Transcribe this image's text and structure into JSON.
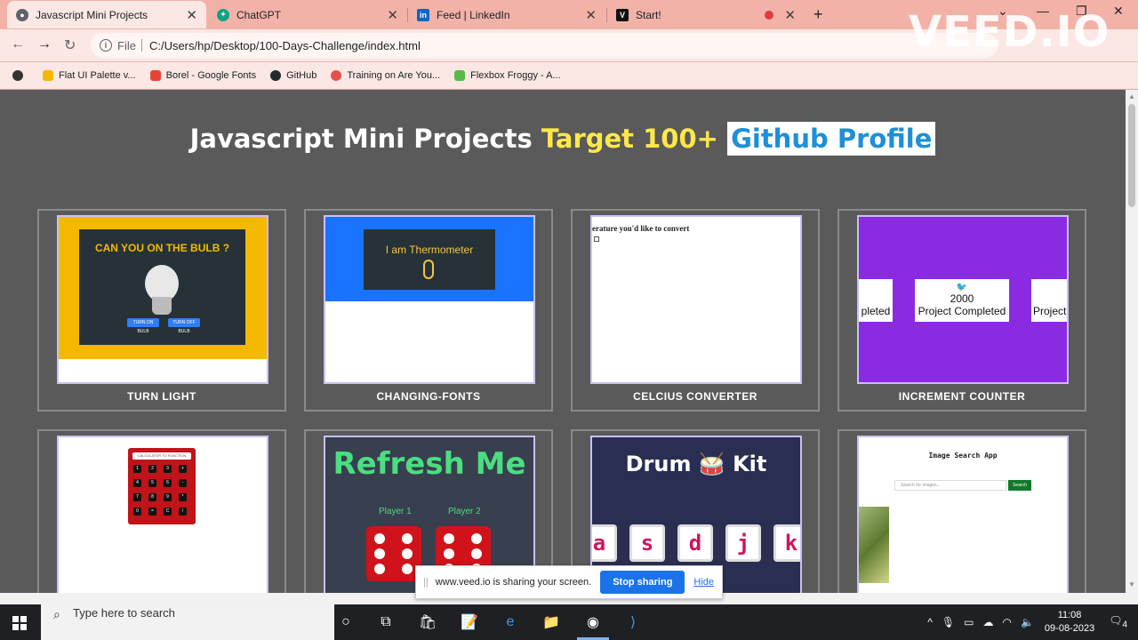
{
  "browser": {
    "tabs": [
      {
        "title": "Javascript Mini Projects",
        "active": true,
        "favicon_color": "#5f6368"
      },
      {
        "title": "ChatGPT",
        "active": false,
        "favicon_color": "#10a37f"
      },
      {
        "title": "Feed | LinkedIn",
        "active": false,
        "favicon_color": "#0a66c2"
      },
      {
        "title": "Start!",
        "active": false,
        "favicon_color": "#111111"
      }
    ],
    "new_tab": "+",
    "address": {
      "scheme": "File",
      "url": "C:/Users/hp/Desktop/100-Days-Challenge/index.html"
    },
    "bookmarks": [
      {
        "label": "Flat UI Palette v...",
        "color": "#f5b800"
      },
      {
        "label": "Borel - Google Fonts",
        "color": "#ea4335"
      },
      {
        "label": "GitHub",
        "color": "#24292e"
      },
      {
        "label": "Training on Are You...",
        "color": "#e94e4e"
      },
      {
        "label": "Flexbox Froggy - A...",
        "color": "#57b947"
      }
    ],
    "watermark": "VEED.IO"
  },
  "page": {
    "heading": {
      "part1": "Javascript Mini Projects",
      "part2": "Target 100+",
      "part3": "Github Profile"
    },
    "cards": [
      {
        "label": "TURN LIGHT"
      },
      {
        "label": "CHANGING-FONTS"
      },
      {
        "label": "CELCIUS CONVERTER"
      },
      {
        "label": "INCREMENT COUNTER"
      },
      {
        "label": ""
      },
      {
        "label": ""
      },
      {
        "label": ""
      },
      {
        "label": ""
      }
    ],
    "thumbs": {
      "bulb_title": "CAN YOU ON THE BULB ?",
      "bulb_btn_on": "TURN ON BULB",
      "bulb_btn_off": "TURN OFF BULB",
      "thermo_title": "I am Thermometer",
      "conv_text": "erature you'd like to convert",
      "counter_left": "pleted",
      "counter_num": "2000",
      "counter_mid": "Project Completed",
      "counter_right": "Project",
      "calc_screen": "CALCULATOR TO FUNCTION",
      "calc_keys": [
        "1",
        "2",
        "3",
        "+",
        "4",
        "5",
        "6",
        "-",
        "7",
        "8",
        "9",
        "*",
        "0",
        "=",
        "C",
        "/"
      ],
      "refresh_title": "Refresh Me",
      "player1": "Player 1",
      "player2": "Player 2",
      "drum_title": "Drum 🥁 Kit",
      "drum_keys": [
        "a",
        "s",
        "d",
        "j",
        "k"
      ],
      "img_title": "Image Search App",
      "img_placeholder": "Search for images...",
      "img_button": "Search"
    }
  },
  "share_banner": {
    "text": "www.veed.io is sharing your screen.",
    "stop": "Stop sharing",
    "hide": "Hide"
  },
  "taskbar": {
    "search_placeholder": "Type here to search",
    "time": "11:08",
    "date": "09-08-2023",
    "notifications": "4"
  }
}
